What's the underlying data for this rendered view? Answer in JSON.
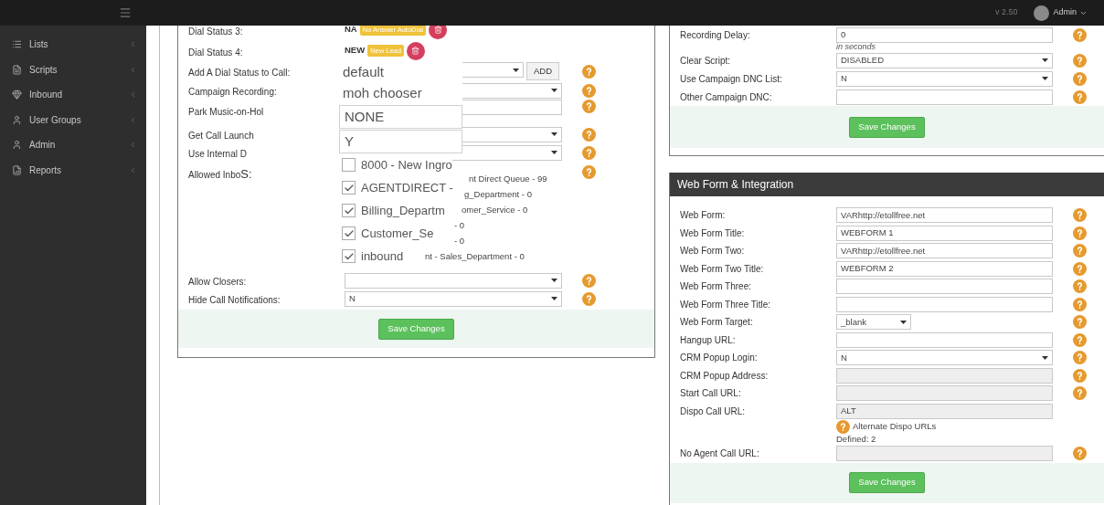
{
  "topbar": {
    "version": "v 2.50",
    "user": "Admin"
  },
  "sidebar": {
    "items": [
      {
        "label": "Lists"
      },
      {
        "label": "Scripts"
      },
      {
        "label": "Inbound"
      },
      {
        "label": "User Groups"
      },
      {
        "label": "Admin"
      },
      {
        "label": "Reports"
      }
    ]
  },
  "campaign_form": {
    "rows": [
      {
        "kind": "status",
        "label": "Dial Status 3:",
        "code": "NA",
        "badge": "No Answer AutoDial"
      },
      {
        "kind": "status",
        "label": "Dial Status 4:",
        "code": "NEW",
        "badge": "New Lead"
      },
      {
        "kind": "select_add",
        "label": "Add A Dial Status to Call:",
        "button": "ADD",
        "help": true
      },
      {
        "kind": "select",
        "label": "Campaign Recording:",
        "help": true
      },
      {
        "kind": "input",
        "label": "Park Music-on-Hol",
        "help": true
      },
      {
        "kind": "select",
        "label": "Get Call Launch",
        "help": true
      },
      {
        "kind": "select",
        "label": "Use Internal D",
        "help": true
      },
      {
        "kind": "list",
        "label": "Allowed Inbo",
        "label_tail": "S:",
        "help": true,
        "items": [
          "nt Direct Queue - 99",
          "g_Department - 0",
          "omer_Service - 0",
          "- 0",
          "- 0",
          "nt - Sales_Department - 0"
        ]
      },
      {
        "kind": "select",
        "label": "Allow Closers:",
        "help": true
      },
      {
        "kind": "select",
        "label": "Hide Call Notifications:",
        "value": "N",
        "help": true
      }
    ],
    "save": "Save Changes"
  },
  "zoomed_dropdown": {
    "items": [
      {
        "kind": "text",
        "label": "default"
      },
      {
        "kind": "text",
        "label": "moh chooser"
      },
      {
        "kind": "box",
        "label": "NONE"
      },
      {
        "kind": "box",
        "label": "Y"
      },
      {
        "kind": "checkbox",
        "label": "8000 - New Ingro",
        "checked": false
      },
      {
        "kind": "checkbox",
        "label": "AGENTDIRECT -",
        "checked": true
      },
      {
        "kind": "checkbox",
        "label": "Billing_Departm",
        "checked": true
      },
      {
        "kind": "checkbox",
        "label": "Customer_Se",
        "checked": true
      },
      {
        "kind": "checkbox",
        "label": "inbound",
        "checked": true
      }
    ]
  },
  "recording_panel": {
    "rows": [
      {
        "kind": "input",
        "label": "Recording Delay:",
        "value": "0",
        "note": "in seconds",
        "help": true
      },
      {
        "kind": "select",
        "label": "Clear Script:",
        "value": "DISABLED",
        "help": true
      },
      {
        "kind": "select",
        "label": "Use Campaign DNC List:",
        "value": "N",
        "help": true
      },
      {
        "kind": "input",
        "label": "Other Campaign DNC:",
        "help": true
      }
    ],
    "save": "Save Changes"
  },
  "web_form_panel": {
    "title": "Web Form & Integration",
    "rows": [
      {
        "kind": "input",
        "label": "Web Form:",
        "value": "VARhttp://etollfree.net",
        "help": true
      },
      {
        "kind": "input",
        "label": "Web Form Title:",
        "value": "WEBFORM 1",
        "help": true
      },
      {
        "kind": "input",
        "label": "Web Form Two:",
        "value": "VARhttp://etollfree.net",
        "help": true
      },
      {
        "kind": "input",
        "label": "Web Form Two Title:",
        "value": "WEBFORM 2",
        "help": true
      },
      {
        "kind": "input",
        "label": "Web Form Three:",
        "help": true
      },
      {
        "kind": "input",
        "label": "Web Form Three Title:",
        "help": true
      },
      {
        "kind": "small_select",
        "label": "Web Form Target:",
        "value": "_blank",
        "help": true
      },
      {
        "kind": "input",
        "label": "Hangup URL:",
        "help": true
      },
      {
        "kind": "select",
        "label": "CRM Popup Login:",
        "value": "N",
        "help": true
      },
      {
        "kind": "input",
        "label": "CRM Popup Address:",
        "disabled": true,
        "help": true
      },
      {
        "kind": "input",
        "label": "Start Call URL:",
        "disabled": true,
        "help": true
      },
      {
        "kind": "input",
        "label": "Dispo Call URL:",
        "value": "ALT",
        "disabled": true,
        "help": false
      },
      {
        "kind": "alt_note",
        "link": "Alternate Dispo URLs",
        "note": "Defined: 2",
        "help": true
      },
      {
        "kind": "input",
        "label": "No Agent Call URL:",
        "disabled": true,
        "help": true
      }
    ],
    "save": "Save Changes"
  }
}
